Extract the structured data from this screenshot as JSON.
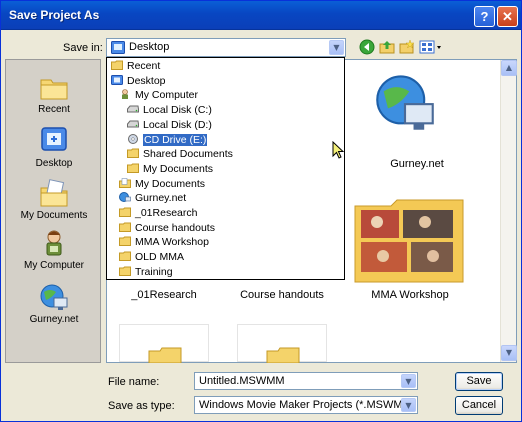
{
  "window": {
    "title": "Save Project As",
    "help": "?",
    "close": "✕"
  },
  "save_in": {
    "label": "Save in:",
    "value": "Desktop"
  },
  "places": [
    {
      "label": "Recent",
      "icon": "recent-folder-icon"
    },
    {
      "label": "Desktop",
      "icon": "desktop-icon"
    },
    {
      "label": "My Documents",
      "icon": "my-documents-icon"
    },
    {
      "label": "My Computer",
      "icon": "my-computer-icon"
    },
    {
      "label": "Gurney.net",
      "icon": "network-icon"
    }
  ],
  "dropdown": [
    {
      "label": "Recent",
      "icon": "folder-icon",
      "indent": 0
    },
    {
      "label": "Desktop",
      "icon": "desktop-icon",
      "indent": 0
    },
    {
      "label": "My Computer",
      "icon": "my-computer-icon",
      "indent": 1
    },
    {
      "label": "Local Disk (C:)",
      "icon": "drive-icon",
      "indent": 2
    },
    {
      "label": "Local Disk (D:)",
      "icon": "drive-icon",
      "indent": 2
    },
    {
      "label": "CD Drive (E:)",
      "icon": "cd-drive-icon",
      "indent": 2,
      "selected": true
    },
    {
      "label": "Shared Documents",
      "icon": "folder-icon",
      "indent": 2
    },
    {
      "label": "My Documents",
      "icon": "folder-icon",
      "indent": 2
    },
    {
      "label": "My Documents",
      "icon": "my-documents-icon",
      "indent": 1
    },
    {
      "label": "Gurney.net",
      "icon": "network-icon",
      "indent": 1
    },
    {
      "label": "_01Research",
      "icon": "folder-icon",
      "indent": 1
    },
    {
      "label": "Course handouts",
      "icon": "folder-icon",
      "indent": 1
    },
    {
      "label": "MMA Workshop",
      "icon": "folder-icon",
      "indent": 1
    },
    {
      "label": "OLD MMA",
      "icon": "folder-icon",
      "indent": 1
    },
    {
      "label": "Training",
      "icon": "folder-icon",
      "indent": 1
    }
  ],
  "files": [
    {
      "label": "Gurney.net",
      "icon": "network-icon"
    },
    {
      "label": "_01Research",
      "icon": "folder-icon"
    },
    {
      "label": "Course handouts",
      "icon": "folder-icon"
    },
    {
      "label": "MMA Workshop",
      "icon": "photo-folder-icon"
    }
  ],
  "file_name": {
    "label": "File name:",
    "value": "Untitled.MSWMM"
  },
  "save_as_type": {
    "label": "Save as type:",
    "value": "Windows Movie Maker Projects (*.MSWMM)"
  },
  "buttons": {
    "save": "Save",
    "cancel": "Cancel"
  },
  "colors": {
    "titlebar": "#0a5fd6",
    "selection": "#316ac5",
    "dialog": "#ece9d8"
  }
}
